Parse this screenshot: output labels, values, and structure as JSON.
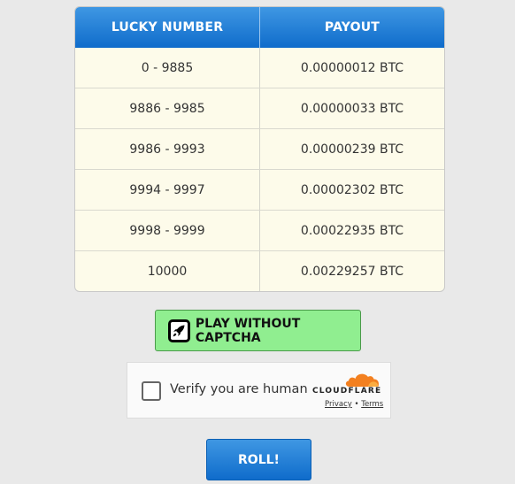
{
  "table": {
    "headers": [
      "LUCKY NUMBER",
      "PAYOUT"
    ],
    "rows": [
      [
        "0 - 9885",
        "0.00000012 BTC"
      ],
      [
        "9886 - 9985",
        "0.00000033 BTC"
      ],
      [
        "9986 - 9993",
        "0.00000239 BTC"
      ],
      [
        "9994 - 9997",
        "0.00002302 BTC"
      ],
      [
        "9998 - 9999",
        "0.00022935 BTC"
      ],
      [
        "10000",
        "0.00229257 BTC"
      ]
    ]
  },
  "play_button": {
    "label": "PLAY WITHOUT CAPTCHA",
    "icon": "rocket-icon",
    "color": "#90ee90"
  },
  "captcha": {
    "label": "Verify you are human",
    "brand": "CLOUDFLARE",
    "privacy": "Privacy",
    "separator": "•",
    "terms": "Terms",
    "brand_color": "#f38020"
  },
  "roll_button": {
    "label": "ROLL!",
    "color": "#1a74d2"
  }
}
